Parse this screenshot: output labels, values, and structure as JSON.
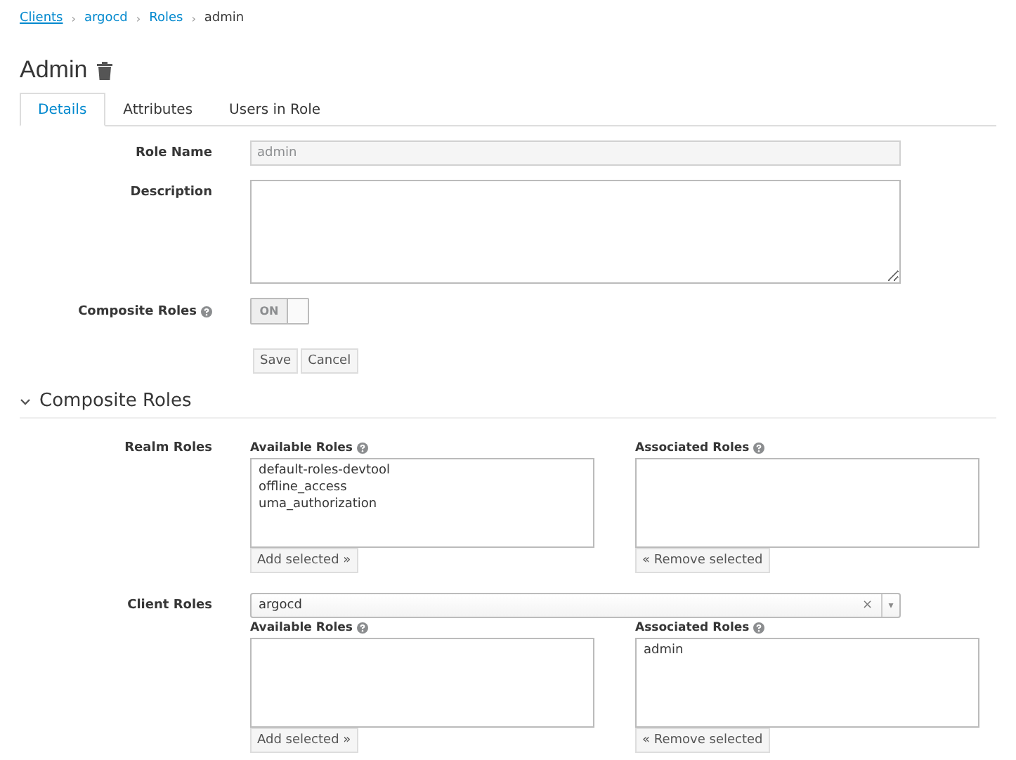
{
  "breadcrumb": [
    {
      "label": "Clients",
      "link": true
    },
    {
      "label": "argocd",
      "link": true
    },
    {
      "label": "Roles",
      "link": true
    },
    {
      "label": "admin",
      "link": false
    }
  ],
  "breadcrumb_separator": "›",
  "title": "Admin",
  "tabs": [
    {
      "label": "Details",
      "selected": true
    },
    {
      "label": "Attributes",
      "selected": false
    },
    {
      "label": "Users in Role",
      "selected": false
    }
  ],
  "form": {
    "role_name": {
      "label": "Role Name",
      "value": "admin",
      "disabled": true
    },
    "description": {
      "label": "Description"
    },
    "composite": {
      "label": "Composite Roles",
      "on": true,
      "text": "ON"
    },
    "buttons": [
      "Save",
      "Cancel"
    ]
  },
  "section": {
    "title": "Composite Roles",
    "expanded": true
  },
  "realm_roles": {
    "label": "Realm Roles",
    "available_label": "Available Roles",
    "available": [
      "default-roles-devtool",
      "offline_access",
      "uma_authorization"
    ],
    "add_button": "Add selected »",
    "associated_label": "Associated Roles",
    "remove_button": "« Remove selected"
  },
  "client_roles": {
    "label": "Client Roles",
    "client": "argocd",
    "clear": "×",
    "caret": "▾",
    "available_label": "Available Roles",
    "add_button": "Add selected »",
    "associated_label": "Associated Roles",
    "associated": [
      "admin"
    ],
    "remove_button": "« Remove selected"
  }
}
